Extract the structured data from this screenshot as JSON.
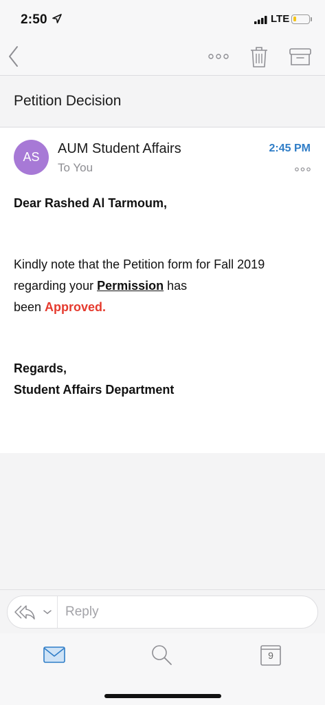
{
  "status_bar": {
    "time": "2:50",
    "network": "LTE",
    "battery_level": 0.2,
    "colors": {
      "battery": "#f5c518"
    }
  },
  "nav": {
    "icons": [
      "back-chevron-icon",
      "more-dots-icon",
      "trash-icon",
      "archive-icon"
    ]
  },
  "subject": "Petition Decision",
  "message": {
    "avatar_initials": "AS",
    "sender": "AUM Student Affairs",
    "recipient": "To You",
    "time": "2:45 PM",
    "colors": {
      "avatar": "#a779d6",
      "time": "#2f7dc7",
      "approved": "#e53a2e"
    },
    "body": {
      "greeting": "Dear Rashed Al Tarmoum,",
      "line1": "Kindly note that the Petition form for Fall 2019",
      "line2_start": "regarding your ",
      "line2_emphasis": "Permission",
      "line2_end": " has",
      "line3_start": "been ",
      "line3_status": "Approved.",
      "closing": "Regards,",
      "signature": "Student Affairs Department"
    }
  },
  "reply": {
    "placeholder": "Reply"
  },
  "tab_bar": {
    "calendar_day": "9",
    "icons": [
      "mail-icon",
      "search-icon",
      "calendar-icon"
    ],
    "colors": {
      "active": "#2f7dc7"
    }
  }
}
